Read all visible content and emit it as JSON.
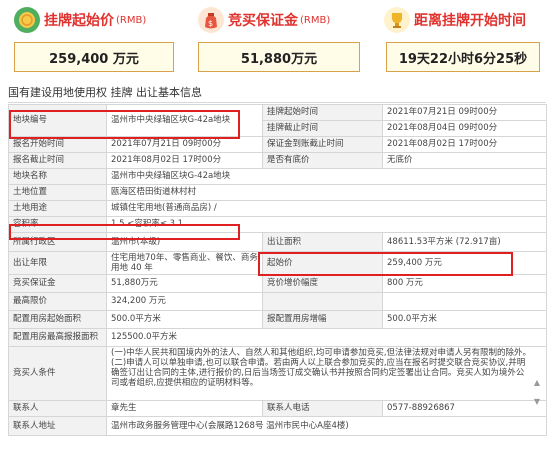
{
  "cards": [
    {
      "title": "挂牌起始价",
      "unit": "(RMB)",
      "value": "259,400 万元",
      "icon": "coin-icon"
    },
    {
      "title": "竞买保证金",
      "unit": "(RMB)",
      "value": "51,880万元",
      "icon": "money-bag-icon"
    },
    {
      "title": "距离挂牌开始时间",
      "unit": "",
      "value": "19天22小时6分25秒",
      "icon": "trophy-icon"
    }
  ],
  "section_title": "国有建设用地使用权 挂牌 出让基本信息",
  "rows": [
    {
      "l1": "地块编号",
      "v1": "温州市中央绿轴区块G-42a地块",
      "l2": "挂牌起始时间",
      "v2": "2021年07月21日 09时00分"
    },
    {
      "l1": "",
      "v1": "",
      "l2": "挂牌截止时间",
      "v2": "2021年08月04日 09时00分"
    },
    {
      "l1": "报名开始时间",
      "v1": "2021年07月21日 09时00分",
      "l2": "保证金到账截止时间",
      "v2": "2021年08月02日 17时00分"
    },
    {
      "l1": "报名截止时间",
      "v1": "2021年08月02日 17时00分",
      "l2": "是否有底价",
      "v2": "无底价"
    },
    {
      "l1": "地块名称",
      "v1": "温州市中央绿轴区块G-42a地块",
      "l2": "",
      "v2": ""
    },
    {
      "l1": "土地位置",
      "v1": "瓯海区梧田街道林村村",
      "l2": "",
      "v2": ""
    },
    {
      "l1": "土地用途",
      "v1": "城镇住宅用地(普通商品房) /",
      "l2": "",
      "v2": ""
    },
    {
      "l1": "容积率",
      "v1": "1.5 <容积率≤ 3.1",
      "l2": "",
      "v2": ""
    },
    {
      "l1": "所属行政区",
      "v1": "温州市(本级)",
      "l2": "出让面积",
      "v2": "48611.53平方米 (72.917亩)"
    },
    {
      "l1": "出让年限",
      "v1": "住宅用地70年、零售商业、餐饮、商务用地 40 年",
      "l2": "起始价",
      "v2": "259,400 万元"
    },
    {
      "l1": "竞买保证金",
      "v1": "51,880万元",
      "l2": "竞价增价幅度",
      "v2": "800 万元"
    },
    {
      "l1": "最高限价",
      "v1": "324,200 万元",
      "l2": "",
      "v2": ""
    },
    {
      "l1": "配置用房起始面积",
      "v1": "500.0平方米",
      "l2": "报配置用房增幅",
      "v2": "500.0平方米"
    },
    {
      "l1": "配置用房最高报报面积",
      "v1": "125500.0平方米",
      "l2": "",
      "v2": ""
    },
    {
      "l1": "竞买人条件",
      "v1": "(一)中华人民共和国境内外的法人、自然人和其他组织,均可申请参加竞买,但法律法规对申请人另有限制的除外。(二)申请人可以单独申请,也可以联合申请。若由两人以上联合参加竞买的,应当在报名时提交联合竞买协议,并明确签订出让合同的主体,进行报价的,日后当场签订成交确认书并按照合同约定签署出让合同。竞买人如为境外公司或者组织,应提供相应的证明材料等。",
      "l2": "",
      "v2": ""
    },
    {
      "l1": "联系人",
      "v1": "章先生",
      "l2": "联系人电话",
      "v2": "0577-88926867"
    },
    {
      "l1": "联系人地址",
      "v1": "温州市政务服务管理中心(会展路1268号 温州市民中心A座4楼)",
      "l2": "",
      "v2": ""
    }
  ]
}
